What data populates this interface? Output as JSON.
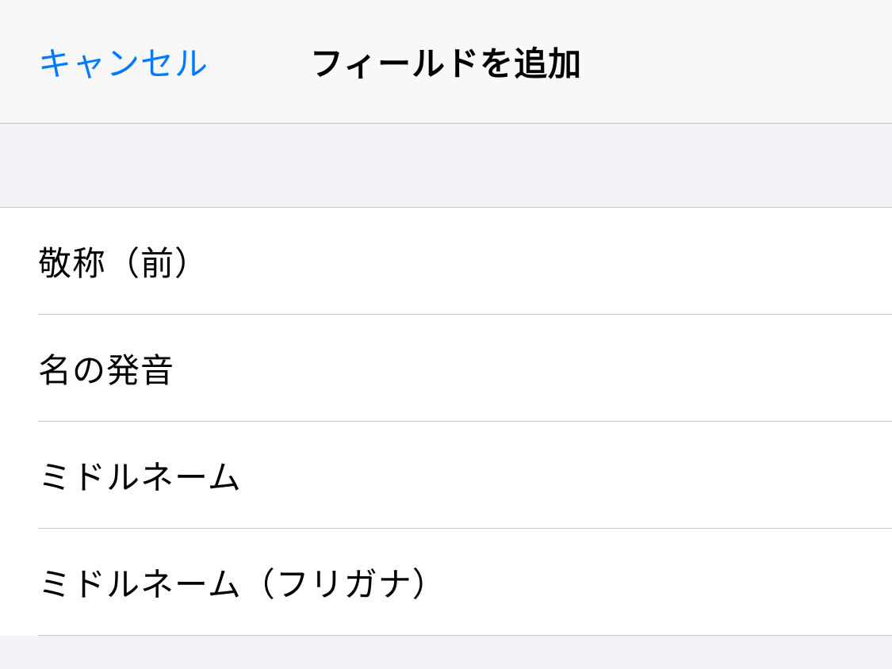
{
  "nav": {
    "cancel_label": "キャンセル",
    "title": "フィールドを追加"
  },
  "fields": {
    "items": [
      {
        "label": "敬称（前）"
      },
      {
        "label": "名の発音"
      },
      {
        "label": "ミドルネーム"
      },
      {
        "label": "ミドルネーム（フリガナ）"
      }
    ]
  }
}
